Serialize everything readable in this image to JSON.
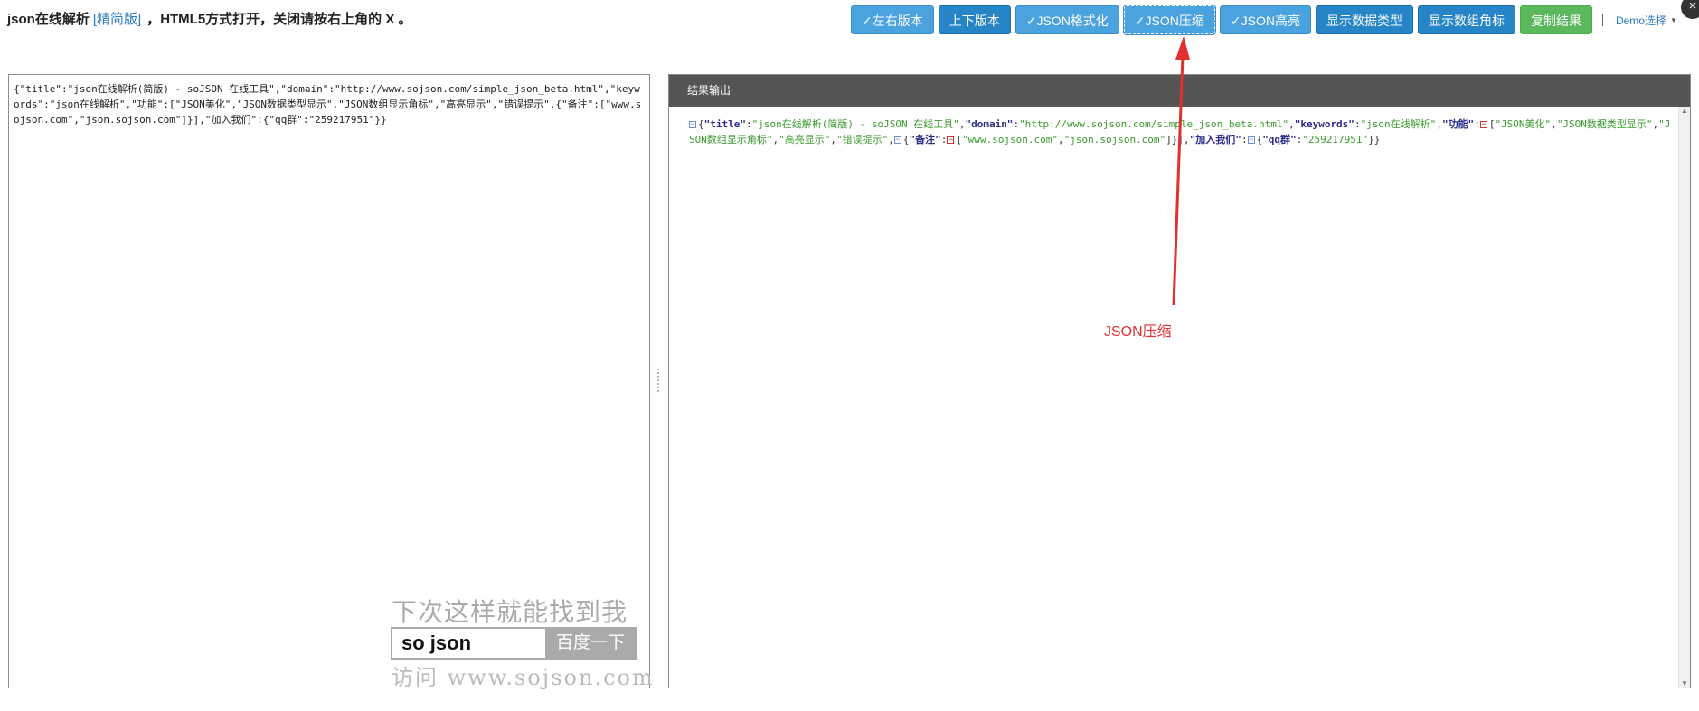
{
  "header": {
    "title_prefix": "json在线解析",
    "title_link": "[精简版]",
    "title_suffix": "，HTML5方式打开，关闭请按右上角的 X 。"
  },
  "toolbar": {
    "buttons": [
      {
        "label": "✓左右版本"
      },
      {
        "label": "上下版本"
      },
      {
        "label": "✓JSON格式化"
      },
      {
        "label": "✓JSON压缩"
      },
      {
        "label": "✓JSON高亮"
      },
      {
        "label": "显示数据类型"
      },
      {
        "label": "显示数组角标"
      },
      {
        "label": "复制结果"
      }
    ],
    "demo_select": "Demo选择"
  },
  "close_label": "×",
  "input": {
    "text": "{\"title\":\"json在线解析(简版) - soJSON 在线工具\",\"domain\":\"http://www.sojson.com/simple_json_beta.html\",\"keywords\":\"json在线解析\",\"功能\":[\"JSON美化\",\"JSON数据类型显示\",\"JSON数组显示角标\",\"高亮显示\",\"错误提示\",{\"备注\":[\"www.sojson.com\",\"json.sojson.com\"]}],\"加入我们\":{\"qq群\":\"259217951\"}}"
  },
  "result": {
    "header": "结果输出",
    "tokens": {
      "title_key": "\"title\"",
      "title_val": "\"json在线解析(简版) - soJSON 在线工具\"",
      "domain_key": "\"domain\"",
      "domain_val": "\"http://www.sojson.com/simple_json_beta.html\"",
      "keywords_key": "\"keywords\"",
      "keywords_val": "\"json在线解析\"",
      "feature_key": "\"功能\"",
      "f1": "\"JSON美化\"",
      "f2": "\"JSON数据类型显示\"",
      "f3": "\"JSON数组显示角标\"",
      "f4": "\"高亮显示\"",
      "f5": "\"错误提示\"",
      "note_key": "\"备注\"",
      "n1": "\"www.sojson.com\"",
      "n2": "\"json.sojson.com\"",
      "join_key": "\"加入我们\"",
      "qq_key": "\"qq群\"",
      "qq_val": "\"259217951\""
    }
  },
  "annotation": {
    "label": "JSON压缩",
    "color": "#e03030"
  },
  "ad": {
    "slogan": "下次这样就能找到我",
    "search_text": "so json",
    "search_button": "百度一下",
    "url": "访问 www.sojson.com"
  },
  "colors": {
    "button_blue": "#2685c7",
    "button_checked": "#4aa3df",
    "button_green": "#5cb85c",
    "result_header_bg": "#555555",
    "json_key": "#2b2b8a",
    "json_string": "#3a9b2e"
  }
}
